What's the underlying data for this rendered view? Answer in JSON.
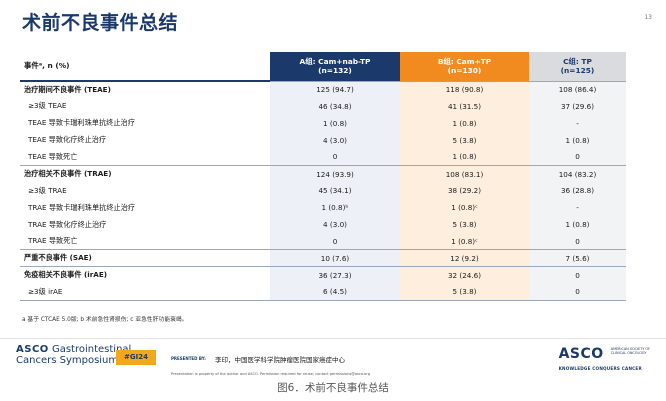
{
  "slide": {
    "title": "术前不良事件总结",
    "page_number": "13"
  },
  "table": {
    "header": {
      "label": "事件ᵃ, n (%)",
      "col_a_line1": "A组: Cam+nab-TP",
      "col_a_line2": "(n=132)",
      "col_b_line1": "B组: Cam+TP",
      "col_b_line2": "(n=130)",
      "col_c_line1": "C组: TP",
      "col_c_line2": "(n=125)"
    },
    "rows": [
      {
        "label": "治疗期间不良事件 (TEAE)",
        "a": "125 (94.7)",
        "b": "118 (90.8)",
        "c": "108 (86.4)"
      },
      {
        "label": "≥3级 TEAE",
        "a": "46 (34.8)",
        "b": "41 (31.5)",
        "c": "37 (29.6)"
      },
      {
        "label": "TEAE 导致卡瑞利珠单抗终止治疗",
        "a": "1 (0.8)",
        "b": "1 (0.8)",
        "c": "-"
      },
      {
        "label": "TEAE 导致化疗终止治疗",
        "a": "4 (3.0)",
        "b": "5 (3.8)",
        "c": "1 (0.8)"
      },
      {
        "label": "TEAE 导致死亡",
        "a": "0",
        "b": "1 (0.8)",
        "c": "0"
      },
      {
        "label": "治疗相关不良事件 (TRAE)",
        "a": "124 (93.9)",
        "b": "108 (83.1)",
        "c": "104 (83.2)"
      },
      {
        "label": "≥3级 TRAE",
        "a": "45 (34.1)",
        "b": "38 (29.2)",
        "c": "36 (28.8)"
      },
      {
        "label": "TRAE 导致卡瑞利珠单抗终止治疗",
        "a": "1 (0.8)ᵇ",
        "b": "1 (0.8)ᶜ",
        "c": "-"
      },
      {
        "label": "TRAE 导致化疗终止治疗",
        "a": "4 (3.0)",
        "b": "5 (3.8)",
        "c": "1 (0.8)"
      },
      {
        "label": "TRAE 导致死亡",
        "a": "0",
        "b": "1 (0.8)ᶜ",
        "c": "0"
      },
      {
        "label": "严重不良事件 (SAE)",
        "a": "10 (7.6)",
        "b": "12 (9.2)",
        "c": "7 (5.6)"
      },
      {
        "label": "免疫相关不良事件 (irAE)",
        "a": "36 (27.3)",
        "b": "32 (24.6)",
        "c": "0"
      },
      {
        "label": "≥3级 irAE",
        "a": "6 (4.5)",
        "b": "5 (3.8)",
        "c": "0"
      }
    ]
  },
  "footnote": "a 基于 CTCAE 5.0版; b 术前急性肾损伤; c 亚急性肝功能衰竭。",
  "footer": {
    "asco_left_brand": "ASCO",
    "asco_left_line1": "Gastrointestinal",
    "asco_left_line2": "Cancers Symposium",
    "hashtag": "#GI24",
    "presented_by_label": "PRESENTED BY:",
    "presenter": "李印，中国医学科学院肿瘤医院国家癌症中心",
    "permission_note": "Presentation is property of the author and ASCO. Permission required for reuse; contact permissions@asco.org",
    "asco_right_logo": "ASCO",
    "asco_right_society_1": "AMERICAN SOCIETY OF",
    "asco_right_society_2": "CLINICAL ONCOLOGY",
    "asco_right_tagline": "KNOWLEDGE CONQUERS CANCER"
  },
  "caption": "图6．术前不良事件总结",
  "colors": {
    "navy": "#1b3a6b",
    "orange": "#f18a1f",
    "gray_header": "#d9dbde",
    "hashtag_yellow": "#f1a81c"
  }
}
